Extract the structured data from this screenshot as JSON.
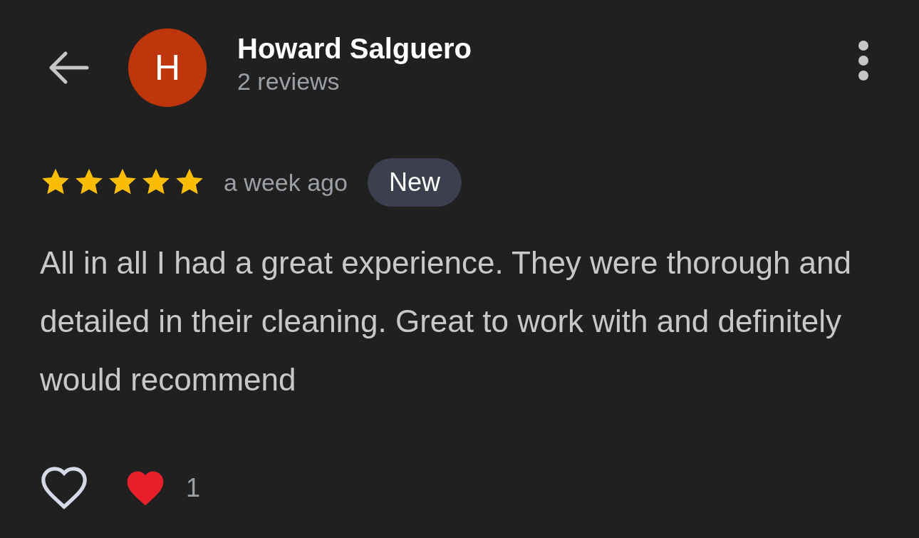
{
  "reviewer": {
    "initial": "H",
    "name": "Howard Salguero",
    "reviews_count": "2 reviews"
  },
  "review": {
    "stars": 5,
    "time": "a week ago",
    "badge": "New",
    "text": "All in all I had a great experience. They were thorough and detailed in their cleaning. Great to work with and definitely would recommend"
  },
  "reactions": {
    "liked": false,
    "count": "1"
  }
}
